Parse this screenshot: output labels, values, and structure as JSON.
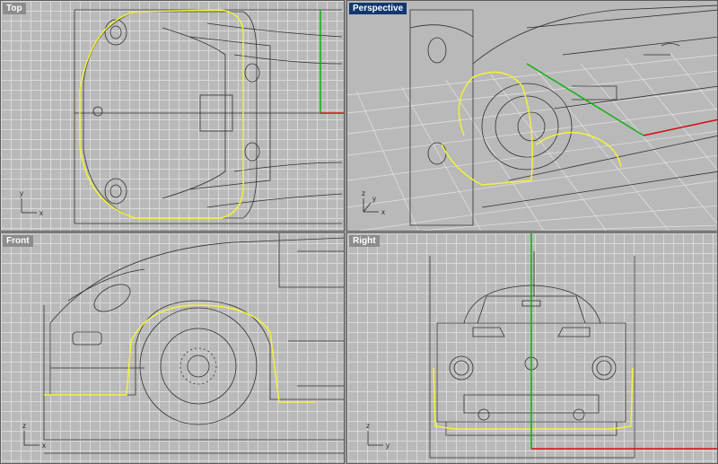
{
  "viewports": [
    {
      "id": "top",
      "label": "Top",
      "axes": [
        "y",
        "x"
      ]
    },
    {
      "id": "perspective",
      "label": "Perspective",
      "axes": [
        "z",
        "y",
        "x"
      ]
    },
    {
      "id": "front",
      "label": "Front",
      "axes": [
        "z",
        "x"
      ]
    },
    {
      "id": "right",
      "label": "Right",
      "axes": [
        "z",
        "y"
      ]
    }
  ],
  "colors": {
    "grid": "#d9d9d9",
    "background": "#b9b9b9",
    "curve": "#f2f23a",
    "x_axis": "#d01010",
    "y_axis": "#10b010",
    "active_label": "#10386e",
    "inactive_label": "#8c8c8c"
  },
  "active_viewport": "perspective"
}
